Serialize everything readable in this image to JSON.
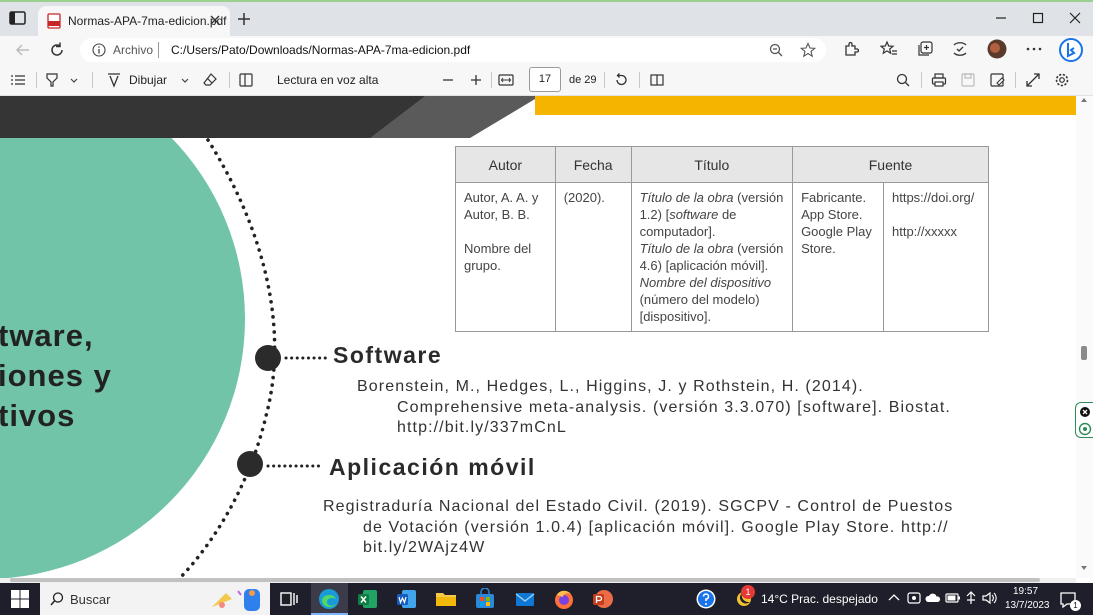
{
  "browser": {
    "tab_title": "Normas-APA-7ma-edicion.pdf",
    "archivo_label": "Archivo",
    "url": "C:/Users/Pato/Downloads/Normas-APA-7ma-edicion.pdf"
  },
  "pdf_toolbar": {
    "draw_label": "Dibujar",
    "read_aloud_label": "Lectura en voz alta",
    "current_page": "17",
    "total_pages": "de 29"
  },
  "document": {
    "side_lines": [
      "tware,",
      "iones y",
      "tivos"
    ],
    "table": {
      "headers": [
        "Autor",
        "Fecha",
        "Título",
        "Fuente"
      ],
      "autor": [
        "Autor, A. A. y",
        "Autor, B. B.",
        "Nombre del",
        "grupo."
      ],
      "fecha": "(2020).",
      "titulo": {
        "l1_italic": "Título de la obra",
        "l1_rest": " (versión",
        "l2_a": "1.2) [",
        "l2_italic": "software",
        "l2_b": " de",
        "l3": "computador].",
        "l4_italic": "Título de la obra",
        "l4_rest": " (versión",
        "l5": "4.6) [aplicación móvil].",
        "l6_italic": "Nombre del dispositivo",
        "l7": "(número del modelo)",
        "l8": "[dispositivo]."
      },
      "fuente_left": [
        "Fabricante.",
        "App Store.",
        "Google Play",
        "Store."
      ],
      "fuente_right": [
        "https://doi.org/",
        "http://xxxxx"
      ]
    },
    "software": {
      "heading": "Software",
      "lines": [
        "Borenstein, M., Hedges, L., Higgins, J. y Rothstein, H. (2014).",
        "Comprehensive meta-analysis. (versión 3.3.070) [software]. Biostat.",
        "http://bit.ly/337mCnL"
      ]
    },
    "app": {
      "heading": "Aplicación móvil",
      "lines": [
        "Registraduría Nacional del Estado Civil. (2019). SGCPV - Control de Puestos",
        "de Votación (versión 1.0.4) [aplicación móvil]. Google Play Store. http://",
        "bit.ly/2WAjz4W"
      ]
    }
  },
  "taskbar": {
    "search_placeholder": "Buscar",
    "weather": "14°C  Prac. despejado",
    "time": "19:57",
    "date": "13/7/2023",
    "notification_badge": "1",
    "notif_count": "1"
  },
  "colors": {
    "teal": "#72c4a8",
    "yellow": "#f4b400",
    "dark": "#353535"
  }
}
